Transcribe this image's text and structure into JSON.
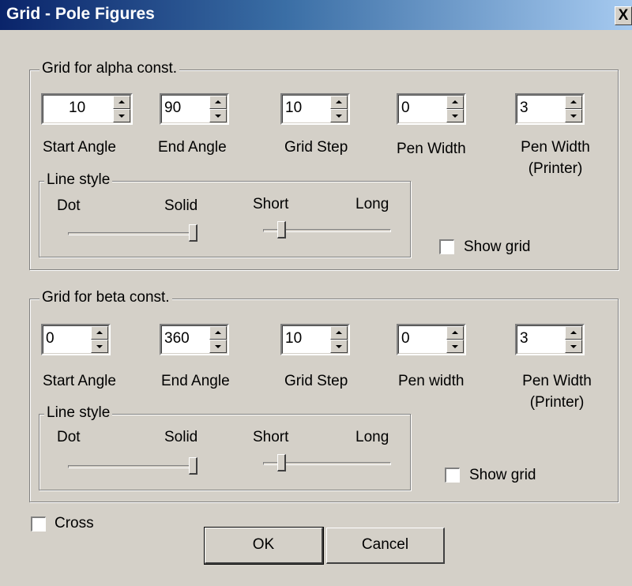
{
  "window": {
    "title": "Grid - Pole Figures",
    "close_glyph": "X"
  },
  "alpha": {
    "group_label": "Grid for alpha const.",
    "start_angle": {
      "value": "10",
      "label": "Start Angle"
    },
    "end_angle": {
      "value": "90",
      "label": "End Angle"
    },
    "grid_step": {
      "value": "10",
      "label": "Grid Step"
    },
    "pen_width": {
      "value": "0",
      "label": "Pen Width"
    },
    "pen_width_printer": {
      "value": "3",
      "label_line1": "Pen Width",
      "label_line2": "(Printer)"
    },
    "line_style": {
      "group_label": "Line style",
      "dot": "Dot",
      "solid": "Solid",
      "short": "Short",
      "long": "Long",
      "dot_solid_level": 1.0,
      "short_long_level": 0.12
    },
    "show_grid": {
      "label": "Show grid",
      "checked": false
    }
  },
  "beta": {
    "group_label": "Grid for beta const.",
    "start_angle": {
      "value": "0",
      "label": "Start Angle"
    },
    "end_angle": {
      "value": "360",
      "label": "End Angle"
    },
    "grid_step": {
      "value": "10",
      "label": "Grid Step"
    },
    "pen_width": {
      "value": "0",
      "label": "Pen width"
    },
    "pen_width_printer": {
      "value": "3",
      "label_line1": "Pen Width",
      "label_line2": "(Printer)"
    },
    "line_style": {
      "group_label": "Line style",
      "dot": "Dot",
      "solid": "Solid",
      "short": "Short",
      "long": "Long",
      "dot_solid_level": 1.0,
      "short_long_level": 0.12
    },
    "show_grid": {
      "label": "Show grid",
      "checked": false
    }
  },
  "cross": {
    "label": "Cross",
    "checked": false
  },
  "buttons": {
    "ok": "OK",
    "cancel": "Cancel"
  },
  "colors": {
    "face": "#d4d0c8",
    "title_start": "#0a246a",
    "title_end": "#a6caf0"
  }
}
